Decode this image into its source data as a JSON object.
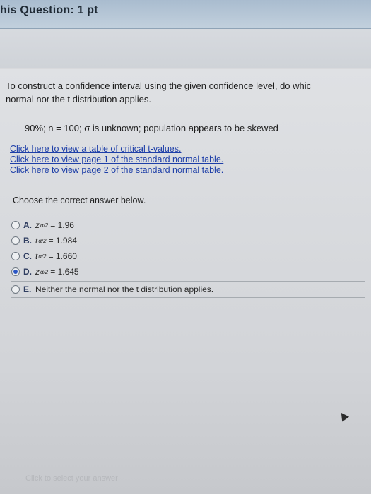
{
  "header": {
    "title": "his Question: 1 pt"
  },
  "question": {
    "text_line1": "To construct a confidence interval using the given confidence level, do whic",
    "text_line2": "normal nor the t distribution applies.",
    "parameters": "90%; n = 100; σ is unknown; population appears to be skewed"
  },
  "links": [
    {
      "label": "Click here to view a table of critical t-values."
    },
    {
      "label": "Click here to view page 1 of the standard normal table."
    },
    {
      "label": "Click here to view page 2 of the standard normal table."
    }
  ],
  "prompt": "Choose the correct answer below.",
  "options": [
    {
      "letter": "A.",
      "symbol": "z",
      "subscript": "α/2",
      "value": "= 1.96",
      "selected": false
    },
    {
      "letter": "B.",
      "symbol": "t",
      "subscript": "α/2",
      "value": "= 1.984",
      "selected": false
    },
    {
      "letter": "C.",
      "symbol": "t",
      "subscript": "α/2",
      "value": "= 1.660",
      "selected": false
    },
    {
      "letter": "D.",
      "symbol": "z",
      "subscript": "α/2",
      "value": "= 1.645",
      "selected": true
    },
    {
      "letter": "E.",
      "text": "Neither the normal nor the t distribution applies.",
      "selected": false
    }
  ],
  "footer_hint": "Click to select your answer",
  "colors": {
    "link": "#1e3fa8",
    "header": "#a9bccf",
    "radio_selected": "#2b56c4"
  }
}
